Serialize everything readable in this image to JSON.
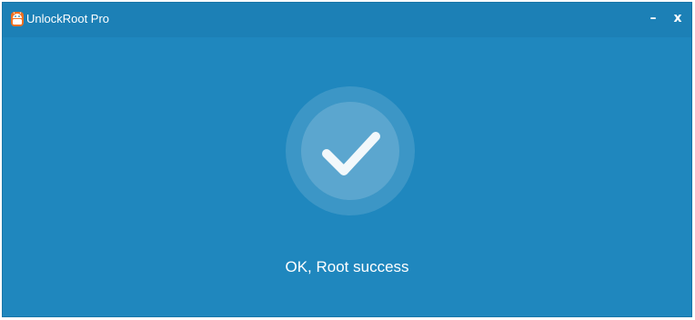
{
  "window": {
    "title": "UnlockRoot Pro",
    "minimize_label": "–",
    "close_label": "x"
  },
  "icons": {
    "app": "android-robot-icon",
    "status": "checkmark-icon"
  },
  "status": {
    "message": "OK, Root success"
  },
  "colors": {
    "background": "#1f87be",
    "titlebar": "#1c80b6",
    "text": "#ffffff"
  }
}
